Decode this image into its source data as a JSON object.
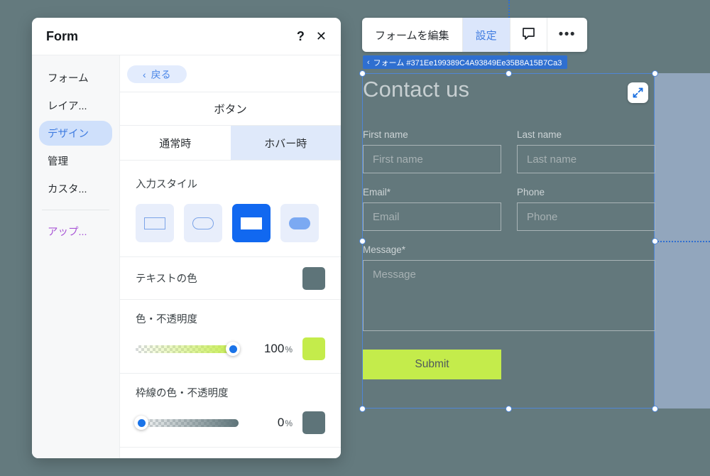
{
  "canvas": {
    "background_color": "#647a7e",
    "selection_overlay_color": "#92a6bd",
    "selection_stroke_color": "#4f86d6"
  },
  "toolbar": {
    "edit_form_label": "フォームを編集",
    "settings_label": "設定",
    "comment_icon": "comment-icon",
    "more_label": "•••",
    "active_color": "#3e7be0",
    "active_bg": "#dbe6fb"
  },
  "id_badge": {
    "chevron": "‹",
    "text": "フォーム #371Ee199389C4A93849Ee35B8A15B7Ca3",
    "background": "#2f6fd0"
  },
  "form_preview": {
    "title": "Contact us",
    "expand_icon": "expand-arrows-icon",
    "text_color": "#c7cfd1",
    "background": "#63787c",
    "fields": [
      {
        "label": "First name",
        "placeholder": "First name",
        "type": "text"
      },
      {
        "label": "Last name",
        "placeholder": "Last name",
        "type": "text"
      },
      {
        "label": "Email*",
        "placeholder": "Email",
        "type": "text"
      },
      {
        "label": "Phone",
        "placeholder": "Phone",
        "type": "text"
      },
      {
        "label": "Message*",
        "placeholder": "Message",
        "type": "textarea"
      }
    ],
    "submit_label": "Submit",
    "submit_color": "#c4ec4b"
  },
  "panel": {
    "title": "Form",
    "help_icon": "?",
    "close_icon": "✕",
    "sidebar": {
      "items": [
        {
          "label": "フォーム",
          "active": false
        },
        {
          "label": "レイア...",
          "active": false
        },
        {
          "label": "デザイン",
          "active": true
        },
        {
          "label": "管理",
          "active": false
        },
        {
          "label": "カスタ...",
          "active": false
        }
      ],
      "upgrade_label": "アップ..."
    },
    "back_button": {
      "chevron": "‹",
      "label": "戻る"
    },
    "section_title": "ボタン",
    "tabs": [
      {
        "label": "通常時",
        "active": true
      },
      {
        "label": "ホバー時",
        "active": false
      }
    ],
    "input_style": {
      "label": "入力スタイル",
      "options": [
        {
          "name": "outline-rect",
          "selected": false
        },
        {
          "name": "outline-pill",
          "selected": false
        },
        {
          "name": "filled-rect",
          "selected": true
        },
        {
          "name": "filled-pill",
          "selected": false
        }
      ]
    },
    "text_color_row": {
      "label": "テキストの色",
      "swatch": "#5e7479"
    },
    "fill_opacity_row": {
      "label": "色・不透明度",
      "value": "100",
      "unit": "%",
      "percent": 100,
      "swatch": "#c4ec4b"
    },
    "border_opacity_row": {
      "label": "枠線の色・不透明度",
      "value": "0",
      "unit": "%",
      "percent": 0,
      "swatch": "#5e7479"
    }
  }
}
